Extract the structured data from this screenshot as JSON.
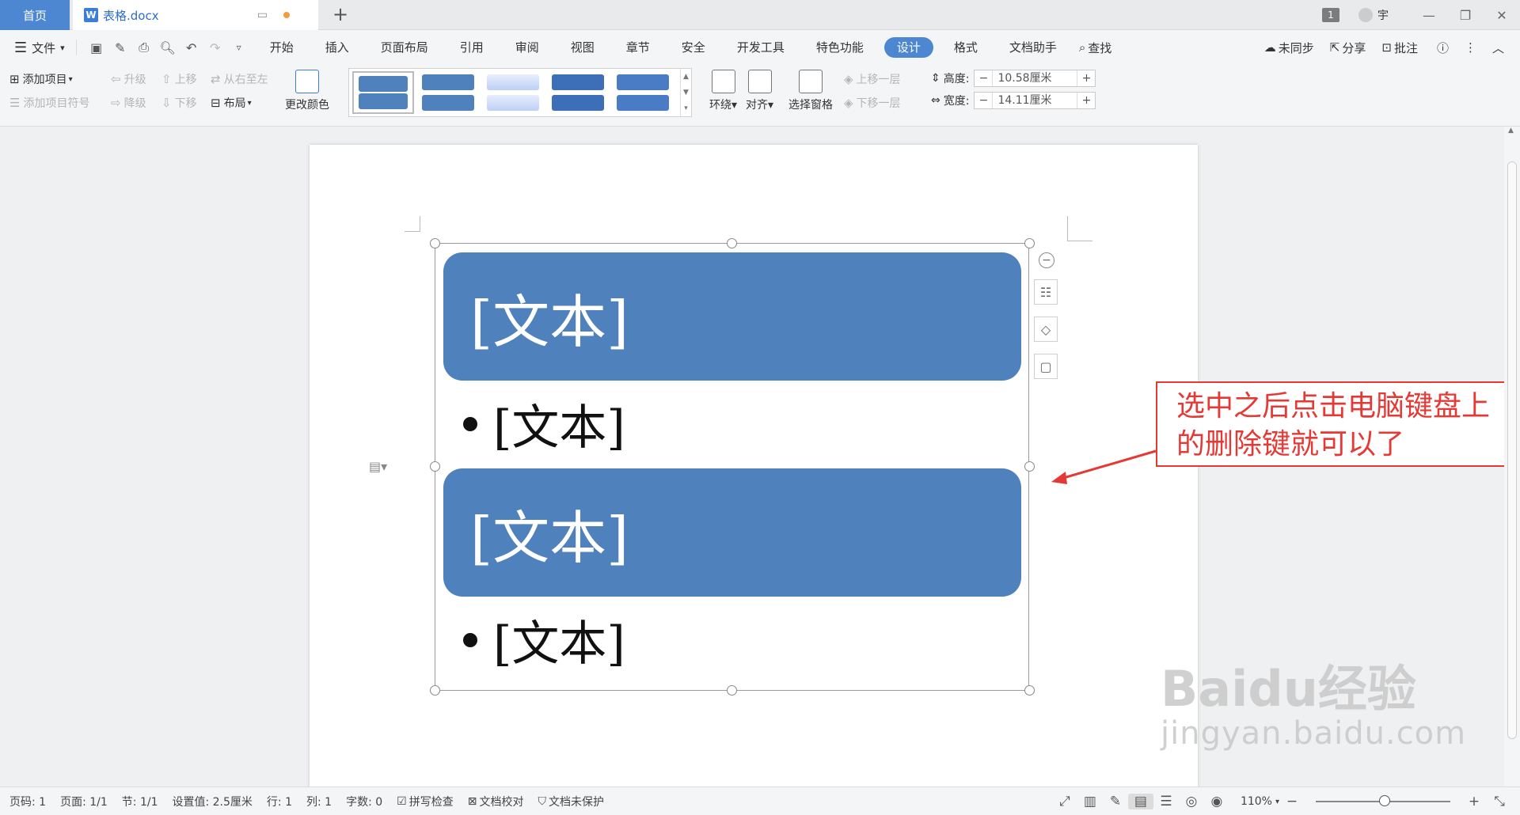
{
  "tabs": {
    "home": "首页",
    "doc": "表格.docx",
    "window_badge": "1",
    "user_name": "宇"
  },
  "menu": {
    "file": "文件",
    "tabs": [
      "开始",
      "插入",
      "页面布局",
      "引用",
      "审阅",
      "视图",
      "章节",
      "安全",
      "开发工具",
      "特色功能",
      "设计",
      "格式",
      "文档助手"
    ],
    "active_tab": "设计",
    "search": "查找",
    "sync": "未同步",
    "share": "分享",
    "comment": "批注"
  },
  "ribbon": {
    "add_item": "添加项目",
    "add_bullet": "添加项目符号",
    "promote": "升级",
    "demote": "降级",
    "move_up": "上移",
    "move_down": "下移",
    "rtl": "从右至左",
    "layout": "布局",
    "change_color": "更改颜色",
    "wrap": "环绕",
    "align": "对齐",
    "select_pane": "选择窗格",
    "bring_forward": "上移一层",
    "send_backward": "下移一层",
    "height_label": "高度:",
    "height_value": "10.58厘米",
    "width_label": "宽度:",
    "width_value": "14.11厘米"
  },
  "document": {
    "shape1": "[文本]",
    "bullet1": "[文本]",
    "shape2": "[文本]",
    "bullet2": "[文本]"
  },
  "annotation": {
    "line1": "选中之后点击电脑键盘上",
    "line2": "的删除键就可以了"
  },
  "watermark": {
    "main": "Baidu经验",
    "sub": "jingyan.baidu.com"
  },
  "status": {
    "page_code": "页码: 1",
    "pages": "页面: 1/1",
    "section": "节: 1/1",
    "setting": "设置值: 2.5厘米",
    "row": "行: 1",
    "col": "列: 1",
    "words": "字数: 0",
    "spell": "拼写检查",
    "proof": "文档校对",
    "protect": "文档未保护",
    "zoom": "110%"
  },
  "colors": {
    "accent": "#4d87d1",
    "smartart": "#4f81bd",
    "annotation": "#e53935"
  }
}
